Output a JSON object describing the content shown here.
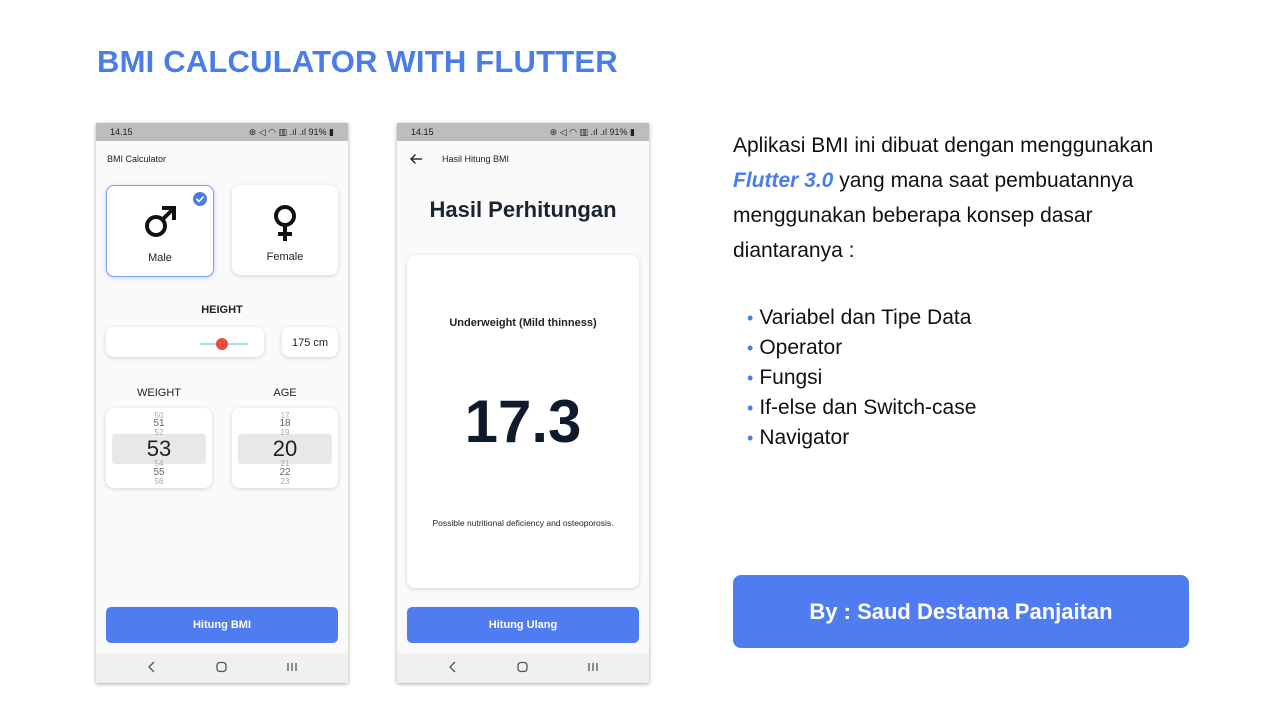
{
  "slide": {
    "title": "BMI CALCULATOR WITH FLUTTER",
    "description_parts": [
      "Aplikasi BMI ini dibuat dengan menggunakan ",
      "Flutter 3.0",
      " yang mana saat pembuatannya menggunakan beberapa konsep dasar diantaranya :"
    ],
    "bullets": [
      "Variabel dan Tipe Data",
      "Operator",
      "Fungsi",
      "If-else dan Switch-case",
      "Navigator"
    ],
    "author": "By : Saud Destama Panjaitan",
    "accent_color": "#4a7de8"
  },
  "status_bar": {
    "time": "14.15",
    "icons_text": "⊛ ◁ ◠ ▥ .ıl .ıl 91% ▮"
  },
  "phone1": {
    "appbar_title": "BMI Calculator",
    "gender": [
      {
        "label": "Male",
        "icon": "male-icon",
        "selected": true
      },
      {
        "label": "Female",
        "icon": "female-icon",
        "selected": false
      }
    ],
    "height_label": "HEIGHT",
    "height_value": "175 cm",
    "weight_label": "WEIGHT",
    "age_label": "AGE",
    "weight_picker": {
      "above_far": "50",
      "above": "51",
      "above_near": "52",
      "selected": "53",
      "below_near": "54",
      "below": "55",
      "below_far": "56"
    },
    "age_picker": {
      "above_far": "17",
      "above": "18",
      "above_near": "19",
      "selected": "20",
      "below_near": "21",
      "below": "22",
      "below_far": "23"
    },
    "button_label": "Hitung BMI"
  },
  "phone2": {
    "appbar_title": "Hasil Hitung BMI",
    "heading": "Hasil Perhitungan",
    "category": "Underweight (Mild thinness)",
    "bmi_value": "17.3",
    "description": "Possible nutritional deficiency and osteoporosis.",
    "button_label": "Hitung Ulang"
  }
}
